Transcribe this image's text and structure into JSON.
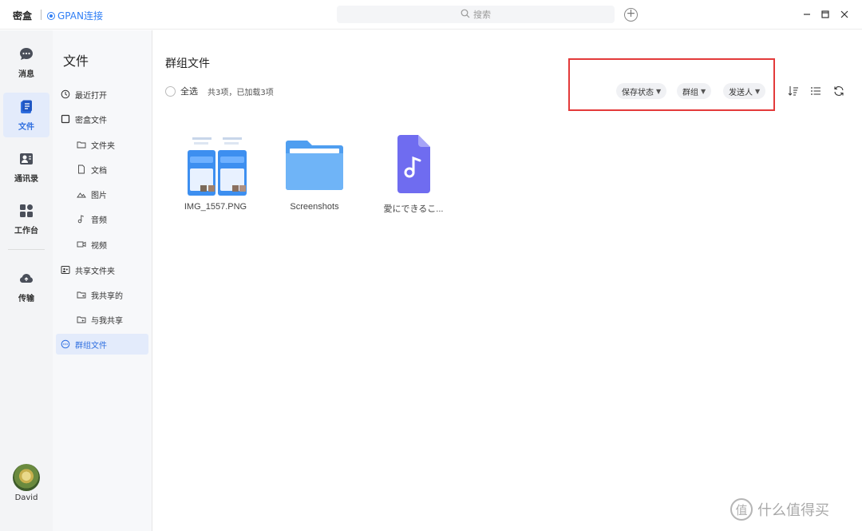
{
  "titlebar": {
    "app_name": "密盒",
    "gpan_label": "GPAN连接",
    "search_placeholder": "搜索"
  },
  "rail": {
    "items": [
      {
        "label": "消息",
        "icon": "chat-bubble-icon"
      },
      {
        "label": "文件",
        "icon": "file-doc-icon",
        "active": true
      },
      {
        "label": "通讯录",
        "icon": "contacts-icon"
      },
      {
        "label": "工作台",
        "icon": "grid-apps-icon"
      },
      {
        "label": "传输",
        "icon": "cloud-transfer-icon"
      }
    ],
    "user_name": "David"
  },
  "sidebar": {
    "title": "文件",
    "items": [
      {
        "label": "最近打开",
        "icon": "clock-icon"
      },
      {
        "label": "密盒文件",
        "icon": "square-box-icon"
      },
      {
        "label": "文件夹",
        "icon": "folder-icon"
      },
      {
        "label": "文档",
        "icon": "document-icon"
      },
      {
        "label": "图片",
        "icon": "image-icon"
      },
      {
        "label": "音频",
        "icon": "music-note-icon"
      },
      {
        "label": "视频",
        "icon": "video-icon"
      },
      {
        "label": "共享文件夹",
        "icon": "shared-folder-icon"
      },
      {
        "label": "我共享的",
        "icon": "folder-share-out-icon"
      },
      {
        "label": "与我共享",
        "icon": "folder-share-in-icon"
      },
      {
        "label": "群组文件",
        "icon": "group-chat-icon",
        "active": true
      }
    ]
  },
  "main": {
    "title": "群组文件",
    "select_all": "全选",
    "count_text": "共3项，已加载3项",
    "filters": [
      "保存状态",
      "群组",
      "发送人"
    ],
    "files": [
      {
        "name": "IMG_1557.PNG",
        "type": "image"
      },
      {
        "name": "Screenshots",
        "type": "folder"
      },
      {
        "name": "愛にできるこ...",
        "type": "audio"
      }
    ]
  },
  "colors": {
    "accent": "#2f7ef5",
    "highlight_box": "#e33a3a",
    "active_bg": "#e3ebfb",
    "folder": "#5aa8f5",
    "audio_tile": "#6f6cf0"
  },
  "watermark": {
    "badge": "值",
    "text": "什么值得买"
  }
}
